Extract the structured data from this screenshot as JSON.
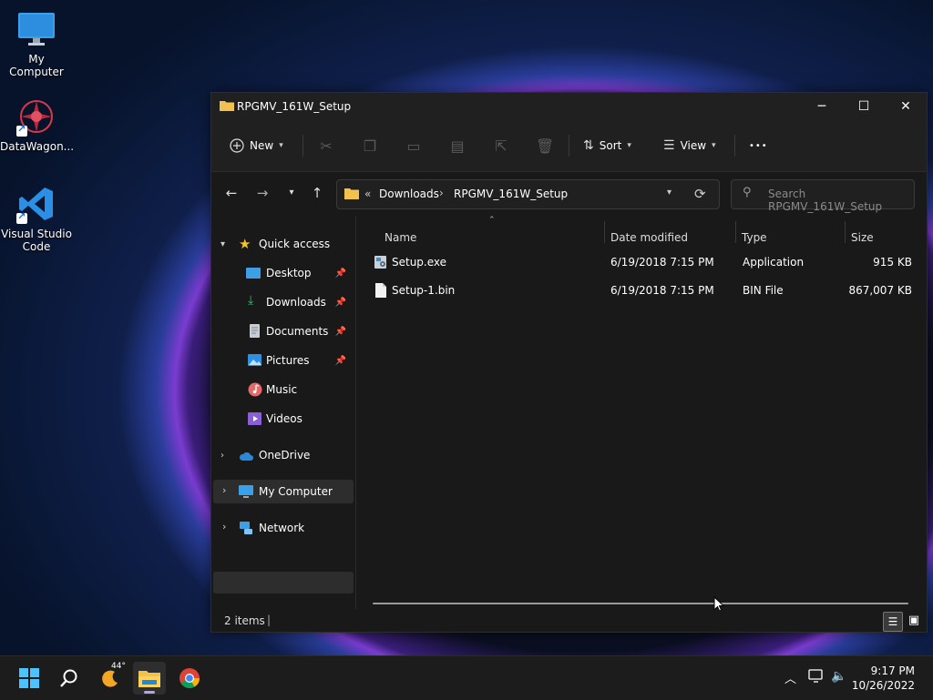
{
  "desktop": {
    "icons": [
      {
        "label": "My Computer"
      },
      {
        "label": "DataWagon..."
      },
      {
        "label": "Visual Studio Code"
      }
    ]
  },
  "window": {
    "title": "RPGMV_161W_Setup",
    "controls": {
      "minimize": "─",
      "maximize": "☐",
      "close": "✕"
    }
  },
  "toolbar": {
    "new_label": "New",
    "sort_label": "Sort",
    "view_label": "View",
    "more_label": "•••"
  },
  "address": {
    "overflow": "«",
    "crumbs": [
      "Downloads",
      "RPGMV_161W_Setup"
    ],
    "separator": "›",
    "search_placeholder": "Search RPGMV_161W_Setup"
  },
  "sidebar": {
    "items": [
      {
        "label": "Quick access"
      },
      {
        "label": "Desktop"
      },
      {
        "label": "Downloads"
      },
      {
        "label": "Documents"
      },
      {
        "label": "Pictures"
      },
      {
        "label": "Music"
      },
      {
        "label": "Videos"
      },
      {
        "label": "OneDrive"
      },
      {
        "label": "My Computer"
      },
      {
        "label": "Network"
      }
    ]
  },
  "columns": {
    "name": "Name",
    "date": "Date modified",
    "type": "Type",
    "size": "Size"
  },
  "files": [
    {
      "name": "Setup.exe",
      "date": "6/19/2018 7:15 PM",
      "type": "Application",
      "size": "915 KB"
    },
    {
      "name": "Setup-1.bin",
      "date": "6/19/2018 7:15 PM",
      "type": "BIN File",
      "size": "867,007 KB"
    }
  ],
  "status": {
    "items_count": "2 items"
  },
  "taskbar": {
    "weather_temp": "44°",
    "time": "9:17 PM",
    "date": "10/26/2022"
  },
  "colors": {
    "accent": "#0078d4",
    "folder": "#f2c14e"
  }
}
